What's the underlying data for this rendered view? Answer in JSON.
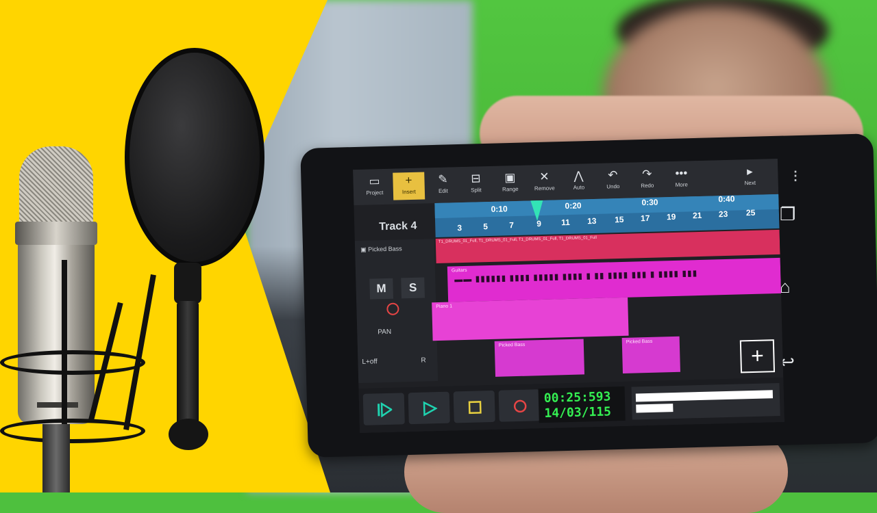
{
  "toolbar": {
    "buttons": [
      {
        "label": "Project",
        "glyph": "▭"
      },
      {
        "label": "Insert",
        "glyph": "+"
      },
      {
        "label": "Edit",
        "glyph": "✎"
      },
      {
        "label": "Split",
        "glyph": "⊟"
      },
      {
        "label": "Range",
        "glyph": "▣"
      },
      {
        "label": "Remove",
        "glyph": "✕"
      },
      {
        "label": "Auto",
        "glyph": "⋀"
      },
      {
        "label": "Undo",
        "glyph": "↶"
      },
      {
        "label": "Redo",
        "glyph": "↷"
      },
      {
        "label": "More",
        "glyph": "•••"
      },
      {
        "label": "Next",
        "glyph": "▸"
      }
    ]
  },
  "track": {
    "title": "Track 4",
    "name": "Picked Bass",
    "mute": "M",
    "solo": "S",
    "pan_label": "PAN",
    "pan_left": "L+off",
    "pan_right": "R"
  },
  "ruler": {
    "times": [
      "0:10",
      "0:20",
      "0:30",
      "0:40"
    ],
    "bars": [
      "3",
      "5",
      "7",
      "9",
      "11",
      "13",
      "15",
      "17",
      "19",
      "21",
      "23",
      "25"
    ]
  },
  "lanes": {
    "red_label": "T1_DRUMS_01_Full,  T1_DRUMS_01_Full,  T1_DRUMS_01_Full,  T1_DRUMS_01_Full",
    "guitar_label": "Guitars",
    "piano_label": "Piano 1",
    "bass_clip_1": "Picked Bass",
    "bass_clip_2": "Picked Bass"
  },
  "transport": {
    "time": "00:25:593",
    "position": "14/03/115"
  },
  "colors": {
    "background_yellow": "#ffd500",
    "timecode_green": "#34ef52",
    "clip_magenta": "#e02cd0",
    "drum_red": "#d8305e"
  }
}
